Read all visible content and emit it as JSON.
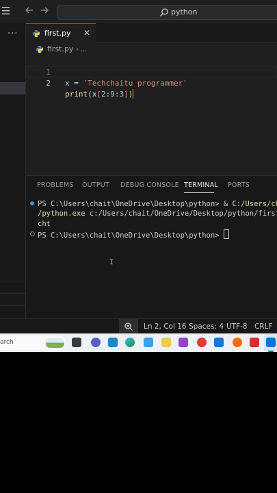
{
  "titlebar": {
    "menu_icon": "ellipsis-menu-icon",
    "back_icon": "arrow-left-icon",
    "forward_icon": "arrow-right-icon",
    "command_center_text": "python"
  },
  "sidebar": {
    "overflow_label": "..."
  },
  "tab": {
    "filename": "first.py",
    "close_glyph": "✕"
  },
  "breadcrumb": {
    "file": "first.py",
    "separator": "›",
    "ellipsis": "..."
  },
  "editor": {
    "line_numbers": [
      "1",
      "2"
    ],
    "line1": {
      "var": "x",
      "op": " = ",
      "str": "'Techchaitu programmer'"
    },
    "line2": {
      "fn": "print",
      "open": "(",
      "var": "x",
      "lb": "[",
      "slice_a": "2",
      "colon1": ":",
      "slice_b": "9",
      "colon2": ":",
      "slice_c": "3",
      "rb": "]",
      "close": ")"
    }
  },
  "panel": {
    "tabs": [
      "PROBLEMS",
      "OUTPUT",
      "DEBUG CONSOLE",
      "TERMINAL",
      "PORTS"
    ],
    "active_tab": "TERMINAL",
    "terminal": {
      "line1_prompt": "PS C:\\Users\\chait\\OneDrive\\Desktop\\python> & ",
      "line1_cmd": "C:/Users/chai",
      "line2_cmd": "/python.exe",
      "line2_rest": " c:/Users/chait/OneDrive/Desktop/python/first.",
      "line3_output": "cht",
      "line4_prompt": "PS C:\\Users\\chait\\OneDrive\\Desktop\\python> "
    }
  },
  "statusbar": {
    "zoom_icon": "zoom-magnifier-icon",
    "position": "Ln 2, Col 16",
    "indent": "Spaces: 4",
    "encoding": "UTF-8",
    "eol": "CRLF"
  },
  "taskbar": {
    "search_label": "arch",
    "colors": {
      "vscode": "#0078d4",
      "bar": "#eef1f6"
    }
  }
}
